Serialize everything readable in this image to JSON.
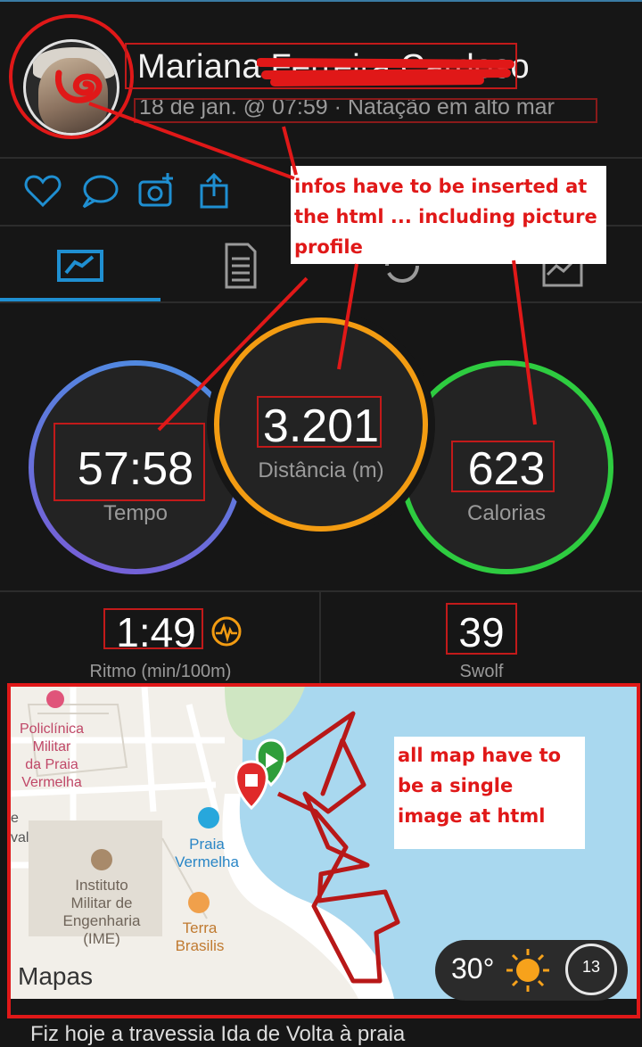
{
  "header": {
    "name": "Mariana Ferreira Cardoso",
    "subtitle": "18 de jan. @ 07:59 · Natação em alto mar"
  },
  "actions": {
    "like_icon": "heart-icon",
    "comment_icon": "comment-icon",
    "photo_icon": "add-photo-icon",
    "share_icon": "share-icon"
  },
  "tabs": [
    {
      "icon": "stats-icon",
      "active": true
    },
    {
      "icon": "details-icon",
      "active": false
    },
    {
      "icon": "laps-icon",
      "active": false
    },
    {
      "icon": "chart-icon",
      "active": false
    }
  ],
  "stats": {
    "time": {
      "value": "57:58",
      "label": "Tempo"
    },
    "distance": {
      "value": "3.201",
      "label": "Distância (m)"
    },
    "calories": {
      "value": "623",
      "label": "Calorias"
    },
    "pace": {
      "value": "1:49",
      "label": "Ritmo (min/100m)"
    },
    "swolf": {
      "value": "39",
      "label": "Swolf"
    }
  },
  "annotations": {
    "note1": "infos have to be inserted at the html ... including picture profile",
    "note2": "all map have to be a single image at html"
  },
  "map": {
    "labels": {
      "policlinica": "Policlínica Militar da Praia Vermelha",
      "praia": "Praia Vermelha",
      "instituto": "Instituto Militar de Engenharia (IME)",
      "terra": "Terra Brasilis",
      "edge_e": "e",
      "edge_val": "val"
    },
    "brand": "Mapas",
    "weather": {
      "temp": "30°",
      "badge": "13"
    }
  },
  "colors": {
    "time_ring": "#4a90e2",
    "distance_ring": "#f39c12",
    "calories_ring": "#2ecc40",
    "accent": "#1f8fd1",
    "annotation": "#e01818"
  },
  "footer": {
    "text": "Fiz hoje a travessia Ida de Volta à praia"
  }
}
